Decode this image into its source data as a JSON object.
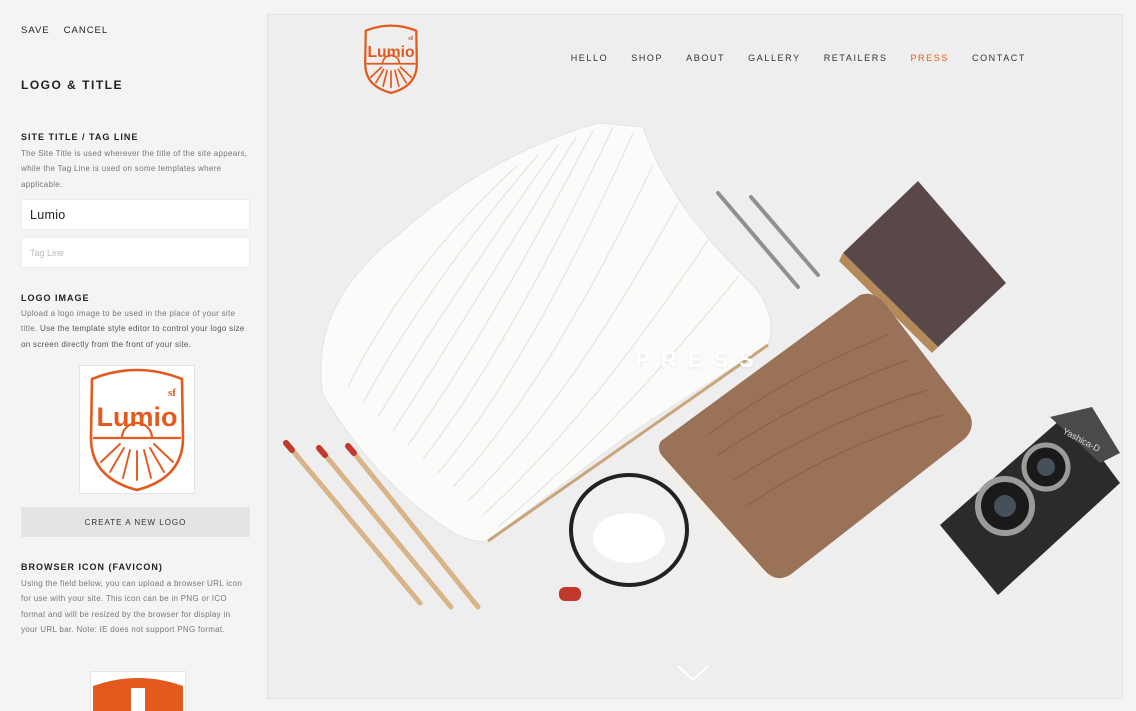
{
  "toolbar": {
    "save_label": "SAVE",
    "cancel_label": "CANCEL"
  },
  "panel": {
    "title": "LOGO & TITLE",
    "site_title_section": {
      "heading": "SITE TITLE / TAG LINE",
      "help": "The Site Title is used wherever the title of the site appears, while the Tag Line is used on some templates where applicable.",
      "title_value": "Lumio",
      "tagline_value": "",
      "tagline_placeholder": "Tag Line"
    },
    "logo_section": {
      "heading": "LOGO IMAGE",
      "help_plain": "Upload a logo image to be used in the place of your site title. ",
      "help_bold": "Use the template style editor to control your logo size on screen directly from the front of your site.",
      "logo_word": "Lumio",
      "logo_sup": "sf",
      "create_button_label": "CREATE A NEW LOGO"
    },
    "favicon_section": {
      "heading": "BROWSER ICON (FAVICON)",
      "help": "Using the field below, you can upload a browser URL icon for use with your site. This icon can be in PNG or ICO format and will be resized by the browser for display in your URL bar. Note: IE does not support PNG format."
    }
  },
  "preview": {
    "logo_word": "Lumio",
    "logo_sup": "sf",
    "nav": [
      {
        "label": "HELLO",
        "active": false
      },
      {
        "label": "SHOP",
        "active": false
      },
      {
        "label": "ABOUT",
        "active": false
      },
      {
        "label": "GALLERY",
        "active": false
      },
      {
        "label": "RETAILERS",
        "active": false
      },
      {
        "label": "PRESS",
        "active": true
      },
      {
        "label": "CONTACT",
        "active": false
      }
    ],
    "page_heading": "PRESS",
    "camera_brand": "Yashica-D"
  },
  "colors": {
    "accent": "#e3591e",
    "sidebar_bg": "#f4f4f4",
    "preview_bg": "#eeeeee",
    "button_bg": "#e4e4e4"
  },
  "icons": {
    "logo": "lumio-shield-logo-icon",
    "favicon": "lumio-favicon-icon",
    "scroll": "chevron-down-icon"
  }
}
